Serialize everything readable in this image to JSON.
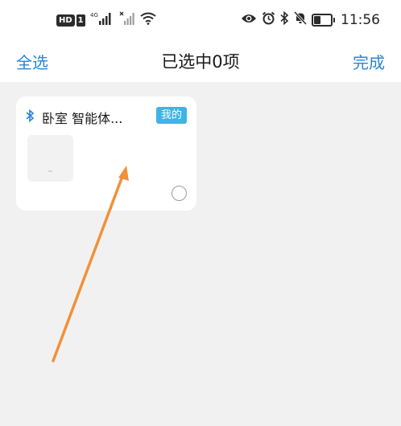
{
  "status_bar": {
    "hd_label": "HD",
    "sim_label": "1",
    "network_label": "4G",
    "time": "11:56",
    "icons": [
      "signal-icon",
      "no-signal-icon",
      "wifi-icon",
      "eye-icon",
      "alarm-icon",
      "bluetooth-icon",
      "mute-bell-icon",
      "battery-icon"
    ]
  },
  "header": {
    "select_all": "全选",
    "title": "已选中0项",
    "done": "完成"
  },
  "device_card": {
    "name": "卧室 智能体...",
    "badge": "我的",
    "selected": false
  },
  "colors": {
    "accent": "#2a85d8",
    "badge_bg": "#3eb4e6",
    "page_bg": "#f1f1f1",
    "arrow": "#f0913a"
  }
}
